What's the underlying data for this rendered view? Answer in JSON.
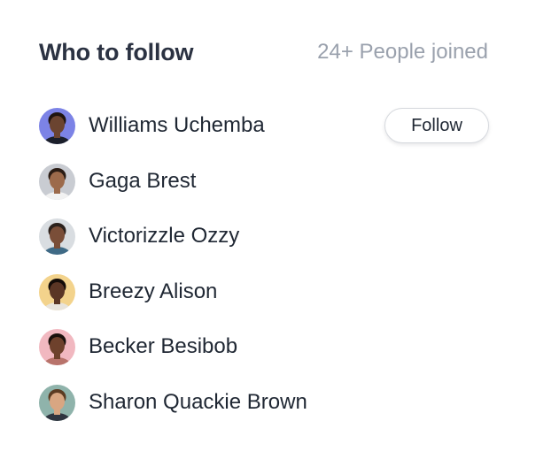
{
  "header": {
    "title": "Who to follow",
    "joined_text": "24+ People joined"
  },
  "follow_button_label": "Follow",
  "people": [
    {
      "name": "Williams Uchemba",
      "avatar_bg": "#7c83e6",
      "skin": "#6b4430",
      "hair": "#1f1410",
      "shirt": "#1b1f2a",
      "has_follow_button": true
    },
    {
      "name": "Gaga Brest",
      "avatar_bg": "#c9ccd2",
      "skin": "#9c6a4b",
      "hair": "#2a1c14",
      "shirt": "#f2f2f2",
      "has_follow_button": false
    },
    {
      "name": "Victorizzle Ozzy",
      "avatar_bg": "#d9dde1",
      "skin": "#7a4e38",
      "hair": "#2b211c",
      "shirt": "#3f6a86",
      "has_follow_button": false
    },
    {
      "name": "Breezy Alison",
      "avatar_bg": "#f3d38c",
      "skin": "#5b3625",
      "hair": "#140c08",
      "shirt": "#e8e4dc",
      "has_follow_button": false
    },
    {
      "name": "Becker Besibob",
      "avatar_bg": "#f1b8c0",
      "skin": "#6e412c",
      "hair": "#1a110c",
      "shirt": "#b8736b",
      "has_follow_button": false
    },
    {
      "name": "Sharon Quackie Brown",
      "avatar_bg": "#8fb3ab",
      "skin": "#d8a682",
      "hair": "#5b3b22",
      "shirt": "#2f3540",
      "has_follow_button": false
    }
  ]
}
